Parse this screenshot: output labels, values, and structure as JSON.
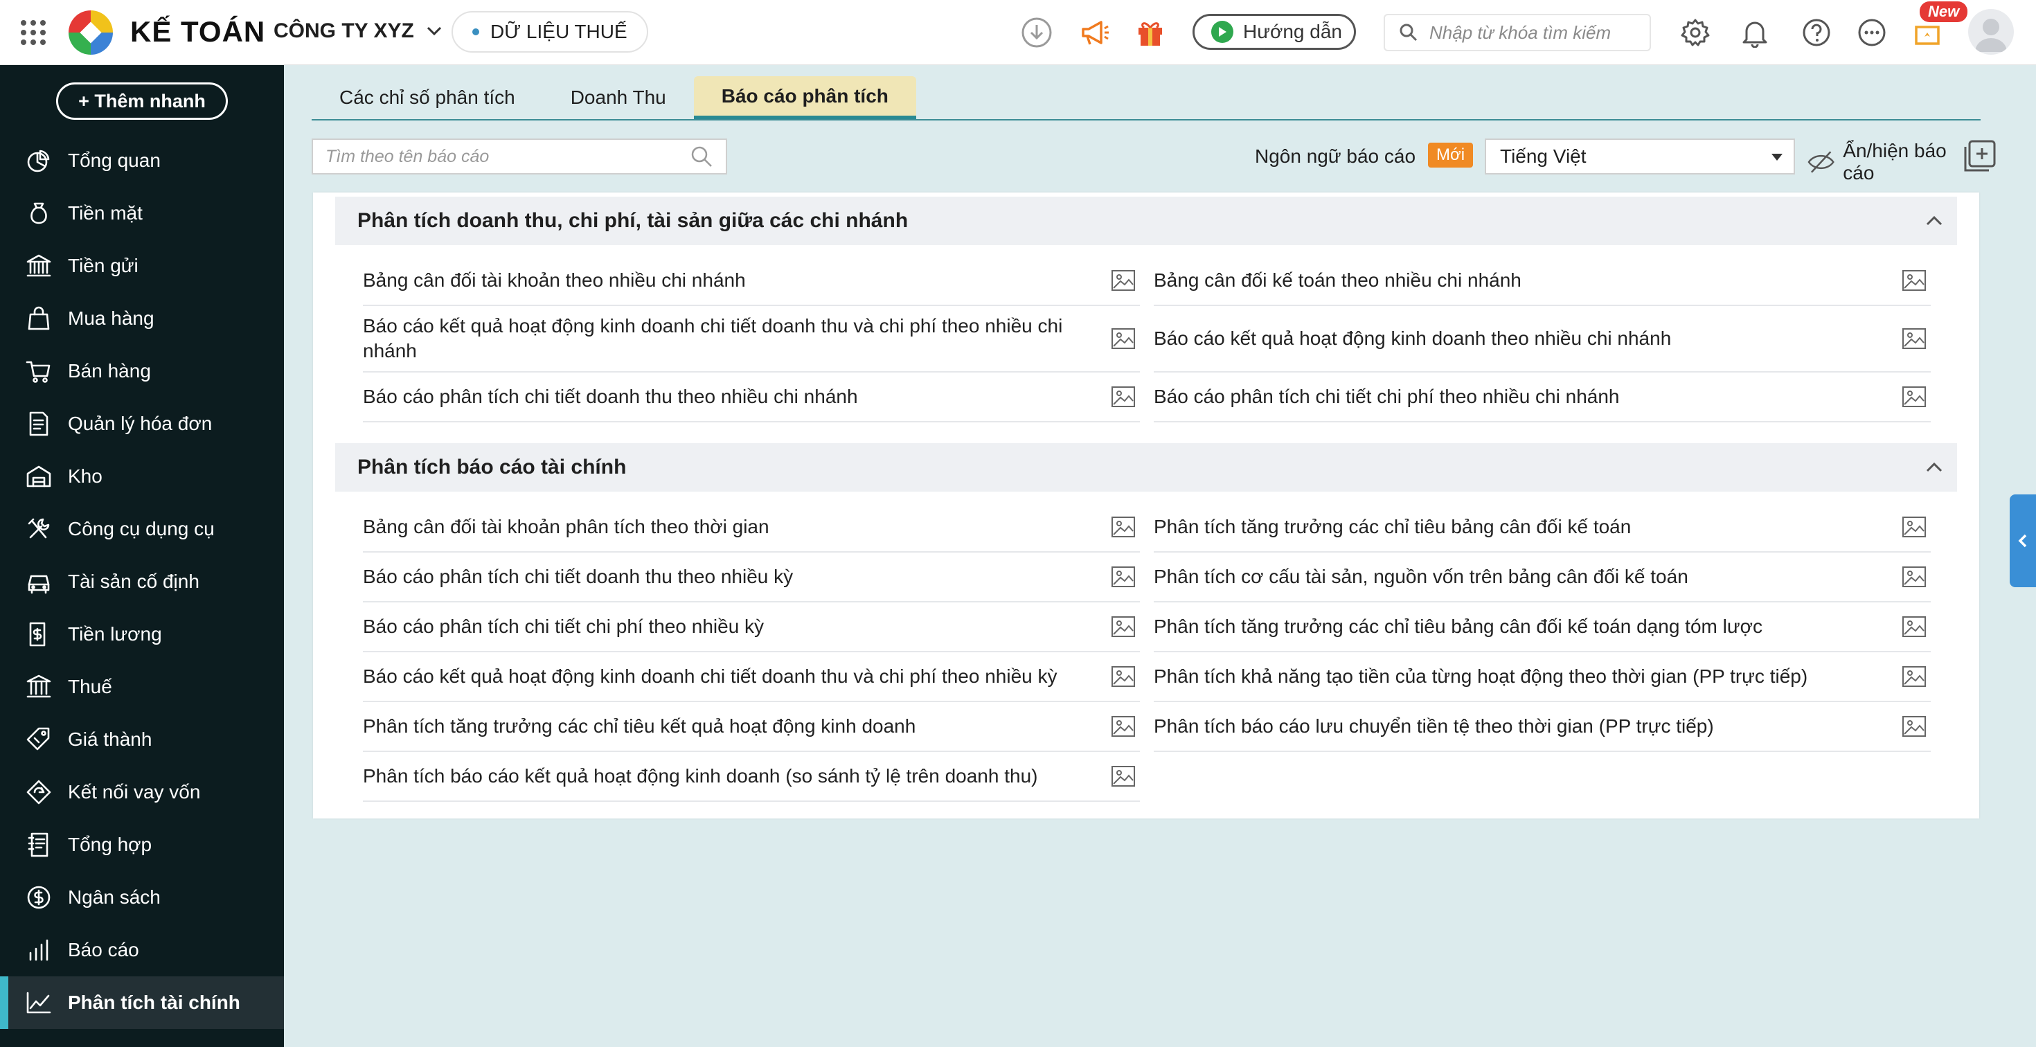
{
  "topbar": {
    "brand": "KẾ TOÁN",
    "company": "CÔNG TY XYZ",
    "tax_data": "DỮ LIỆU THUẾ",
    "guide": "Hướng dẫn",
    "search_placeholder": "Nhập từ khóa tìm kiếm",
    "new_badge": "New"
  },
  "sidebar": {
    "quick_add": "+ Thêm nhanh",
    "items": [
      {
        "label": "Tổng quan",
        "icon": "chart-pie-icon"
      },
      {
        "label": "Tiền mặt",
        "icon": "money-bag-icon"
      },
      {
        "label": "Tiền gửi",
        "icon": "bank-icon"
      },
      {
        "label": "Mua hàng",
        "icon": "shopping-bag-icon"
      },
      {
        "label": "Bán hàng",
        "icon": "cart-icon"
      },
      {
        "label": "Quản lý hóa đơn",
        "icon": "invoice-icon"
      },
      {
        "label": "Kho",
        "icon": "warehouse-icon"
      },
      {
        "label": "Công cụ dụng cụ",
        "icon": "tools-icon"
      },
      {
        "label": "Tài sản cố định",
        "icon": "car-icon"
      },
      {
        "label": "Tiền lương",
        "icon": "payroll-icon"
      },
      {
        "label": "Thuế",
        "icon": "tax-building-icon"
      },
      {
        "label": "Giá thành",
        "icon": "price-tag-icon"
      },
      {
        "label": "Kết nối vay vốn",
        "icon": "loan-icon"
      },
      {
        "label": "Tổng hợp",
        "icon": "ledger-icon"
      },
      {
        "label": "Ngân sách",
        "icon": "budget-icon"
      },
      {
        "label": "Báo cáo",
        "icon": "bar-chart-icon"
      },
      {
        "label": "Phân tích tài chính",
        "icon": "trend-line-icon"
      }
    ],
    "active_index": 16
  },
  "tabs": [
    {
      "label": "Các chỉ số phân tích"
    },
    {
      "label": "Doanh Thu"
    },
    {
      "label": "Báo cáo phân tích"
    }
  ],
  "active_tab": 2,
  "filter": {
    "search_placeholder": "Tìm theo tên báo cáo",
    "language_label": "Ngôn ngữ báo cáo",
    "new_label": "Mới",
    "language_value": "Tiếng Việt",
    "toggle_label": "Ẩn/hiện báo cáo"
  },
  "groups": [
    {
      "title": "Phân tích doanh thu, chi phí, tài sản giữa các chi nhánh",
      "left": [
        "Bảng cân đối tài khoản theo nhiều chi nhánh",
        "Báo cáo kết quả hoạt động kinh doanh chi tiết doanh thu và chi phí theo nhiều chi nhánh",
        "Báo cáo phân tích chi tiết doanh thu theo nhiều chi nhánh"
      ],
      "right": [
        "Bảng cân đối kế toán theo nhiều chi nhánh",
        "Báo cáo kết quả hoạt động kinh doanh theo nhiều chi nhánh",
        "Báo cáo phân tích chi tiết chi phí theo nhiều chi nhánh"
      ]
    },
    {
      "title": "Phân tích báo cáo tài chính",
      "left": [
        "Bảng cân đối tài khoản phân tích theo thời gian",
        "Báo cáo phân tích chi tiết doanh thu theo nhiều kỳ",
        "Báo cáo phân tích chi tiết chi phí theo nhiều kỳ",
        "Báo cáo kết quả hoạt động kinh doanh chi tiết doanh thu và chi phí theo nhiều kỳ",
        "Phân tích tăng trưởng các chỉ tiêu kết quả hoạt động kinh doanh",
        "Phân tích báo cáo kết quả hoạt động kinh doanh (so sánh tỷ lệ trên doanh thu)"
      ],
      "right": [
        "Phân tích tăng trưởng các chỉ tiêu bảng cân đối kế toán",
        "Phân tích cơ cấu tài sản, nguồn vốn trên bảng cân đối kế toán",
        "Phân tích tăng trưởng các chỉ tiêu bảng cân đối kế toán dạng tóm lược",
        "Phân tích khả năng tạo tiền của từng hoạt động theo thời gian (PP trực tiếp)",
        "Phân tích báo cáo lưu chuyển tiền tệ theo thời gian (PP trực tiếp)"
      ]
    }
  ],
  "colors": {
    "accent": "#2a8a93",
    "sidebar_bg": "#0c1c1f",
    "active_tab_bg": "#f0e6b6",
    "new_badge": "#f08a24"
  }
}
